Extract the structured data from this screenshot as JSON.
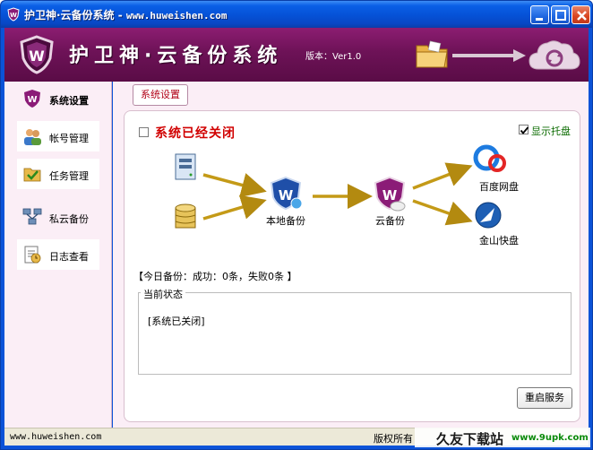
{
  "window": {
    "title": "护卫神·云备份系统",
    "title_url": "www.huweishen.com"
  },
  "banner": {
    "brand": "护卫神·云备份系统",
    "version": "版本：Ver1.0"
  },
  "sidebar": {
    "items": [
      {
        "label": "系统设置",
        "icon": "settings-shield-icon",
        "active": true
      },
      {
        "label": "帐号管理",
        "icon": "users-icon",
        "active": false
      },
      {
        "label": "任务管理",
        "icon": "tasks-icon",
        "active": false
      },
      {
        "label": "私云备份",
        "icon": "network-icon",
        "active": false
      },
      {
        "label": "日志查看",
        "icon": "log-icon",
        "active": false
      }
    ]
  },
  "main": {
    "top_button": "系统设置",
    "status": {
      "label": "系统已经关闭",
      "checked": false
    },
    "tray": {
      "label": "显示托盘",
      "checked": true
    },
    "flow": {
      "local_backup": "本地备份",
      "cloud_backup": "云备份",
      "baidu": "百度网盘",
      "kingsoft": "金山快盘"
    },
    "daily": "【今日备份：成功：0条，失败0条 】",
    "current_status": {
      "legend": "当前状态",
      "text": "[系统已关闭]"
    },
    "restart_button": "重启服务"
  },
  "statusbar": {
    "site": "www.huweishen.com",
    "copyright": "版权所有"
  },
  "watermark": {
    "text1": "久友下载站",
    "text2": "www.9upk.com"
  },
  "colors": {
    "banner": "#6d1257",
    "sidebar_bg": "#fbeef6",
    "status_red": "#d10000",
    "tray_green": "#0b6b00",
    "xp_blue": "#0551d6"
  }
}
